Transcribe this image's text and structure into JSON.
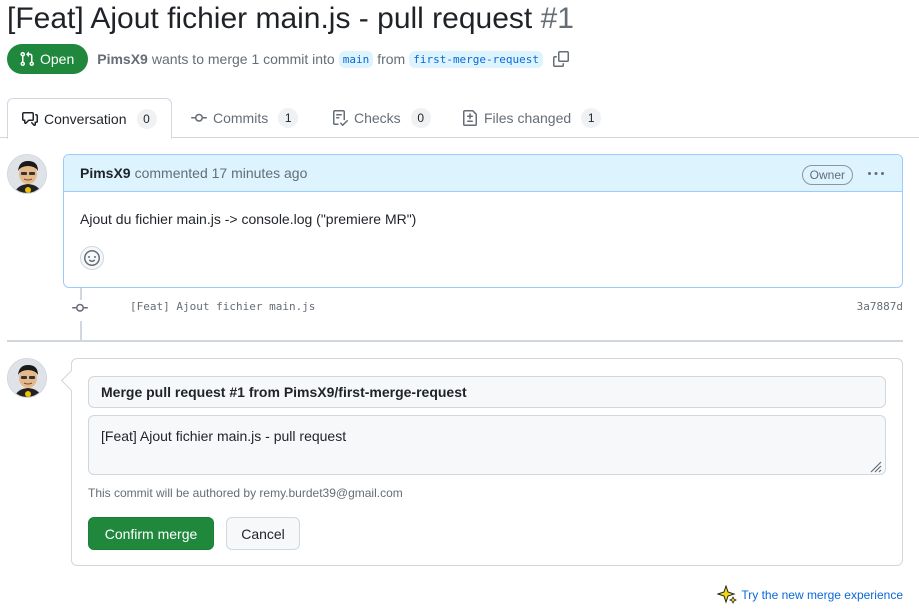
{
  "pr": {
    "title": "[Feat] Ajout fichier main.js - pull request",
    "number": "#1",
    "state": "Open",
    "author": "PimsX9",
    "merge_text_1": "wants to merge 1 commit into",
    "base_branch": "main",
    "merge_text_2": "from",
    "head_branch": "first-merge-request"
  },
  "tabs": [
    {
      "label": "Conversation",
      "count": "0",
      "icon": "comment-discussion-icon"
    },
    {
      "label": "Commits",
      "count": "1",
      "icon": "git-commit-icon"
    },
    {
      "label": "Checks",
      "count": "0",
      "icon": "checklist-icon"
    },
    {
      "label": "Files changed",
      "count": "1",
      "icon": "file-diff-icon"
    }
  ],
  "comment": {
    "author": "PimsX9",
    "meta": "commented 17 minutes ago",
    "badge": "Owner",
    "body": "Ajout du fichier main.js -> console.log (\"premiere MR\")"
  },
  "commit": {
    "message": "[Feat] Ajout fichier main.js",
    "sha": "3a7887d"
  },
  "merge": {
    "title_value": "Merge pull request #1 from PimsX9/first-merge-request",
    "body_value": "[Feat] Ajout fichier main.js - pull request",
    "author_note": "This commit will be authored by remy.burdet39@gmail.com",
    "confirm_label": "Confirm merge",
    "cancel_label": "Cancel"
  },
  "footer": {
    "try_link": "Try the new merge experience"
  },
  "colors": {
    "green": "#1f883d",
    "link_blue": "#0969da",
    "comment_header": "#ddf4ff"
  }
}
